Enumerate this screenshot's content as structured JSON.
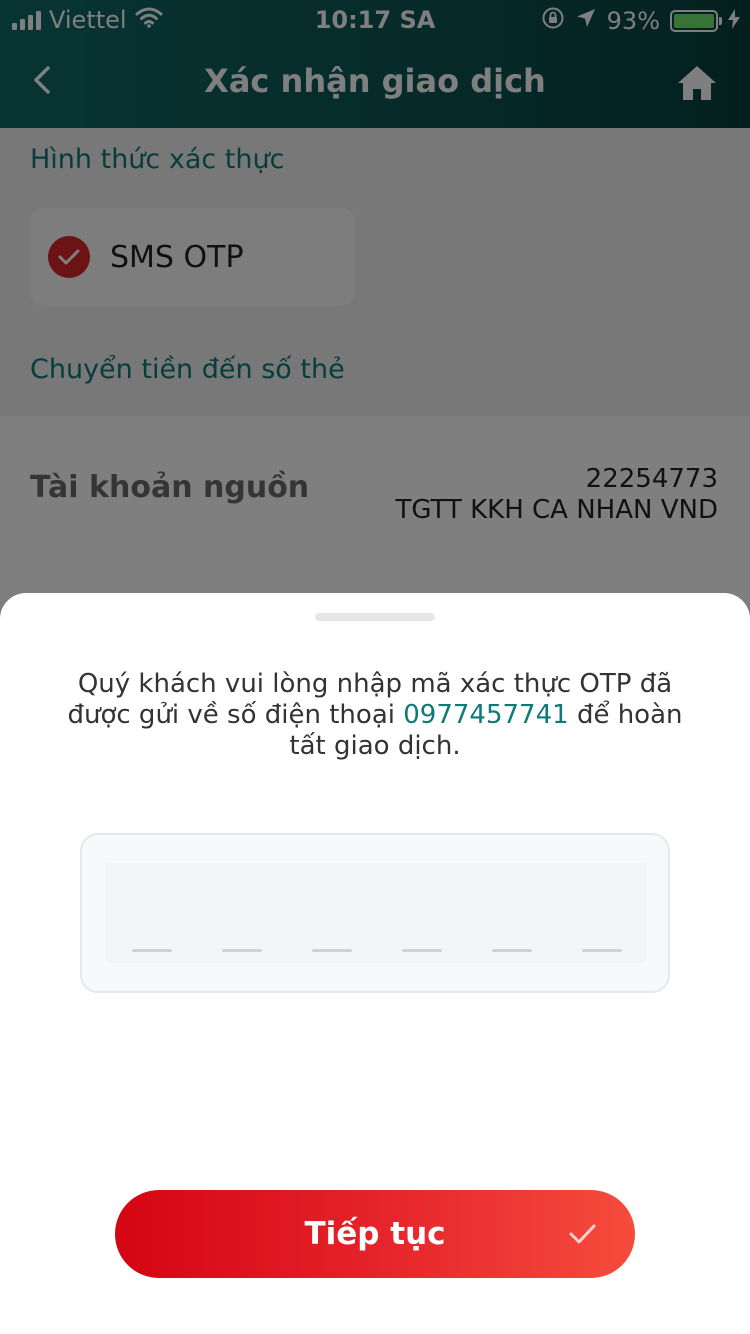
{
  "status_bar": {
    "carrier": "Viettel",
    "time": "10:17 SA",
    "battery_percent": "93%"
  },
  "header": {
    "title": "Xác nhận giao dịch"
  },
  "auth": {
    "section_label": "Hình thức xác thực",
    "method_label": "SMS OTP"
  },
  "transfer": {
    "section_label": "Chuyển tiền đến số thẻ",
    "source_label": "Tài khoản nguồn",
    "source_account_number": "22254773",
    "source_account_name": "TGTT KKH CA NHAN VND"
  },
  "otp_sheet": {
    "message_part1": "Quý khách vui lòng nhập mã xác thực OTP đã được gửi về số điện thoại",
    "phone": "0977457741",
    "message_part2": "để hoàn tất giao dịch.",
    "digit_count": 6
  },
  "continue_button": {
    "label": "Tiếp tục"
  },
  "colors": {
    "header": "#0d5553",
    "accent": "#0e7a78",
    "button": "#e5232b"
  }
}
